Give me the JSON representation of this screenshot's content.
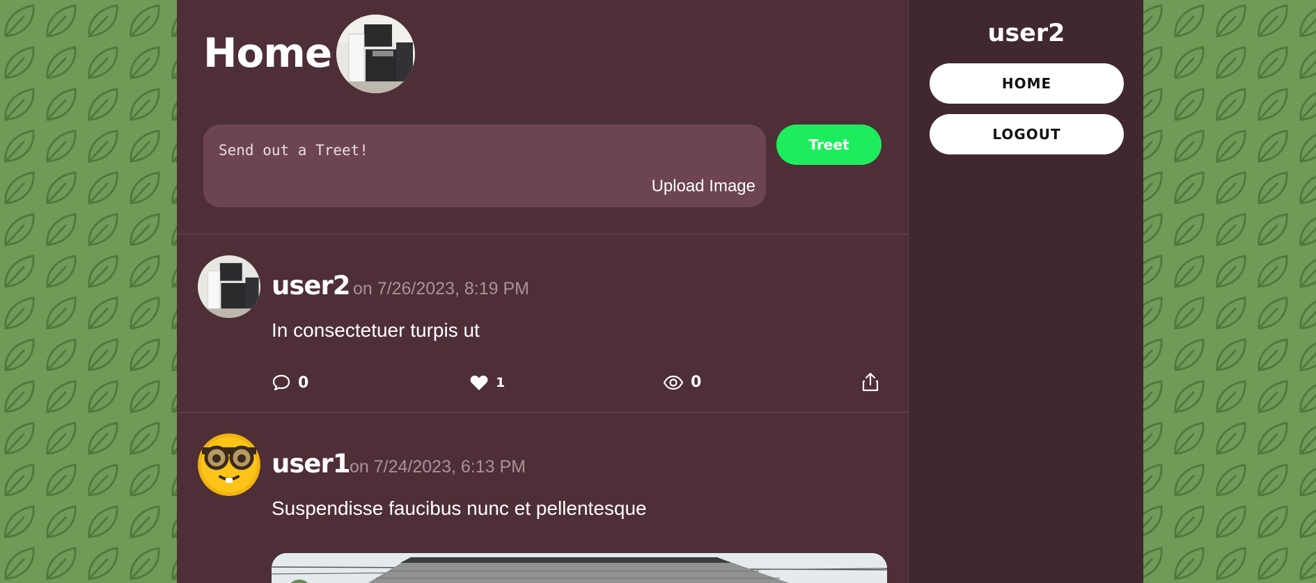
{
  "header": {
    "title": "Home",
    "avatar_icon": "kitchen-photo"
  },
  "compose": {
    "placeholder": "Send out a Treet!",
    "upload_label": "Upload Image",
    "submit_label": "Treet"
  },
  "posts": [
    {
      "username": "user2",
      "date": "on 7/26/2023, 8:19 PM",
      "text": "In consectetuer turpis ut",
      "comments": "0",
      "likes": "1",
      "views": "0",
      "avatar_icon": "kitchen-photo"
    },
    {
      "username": "user1",
      "date": "on 7/24/2023, 6:13 PM",
      "text": "Suspendisse faucibus nunc et pellentesque",
      "avatar_icon": "nerd-face-emoji",
      "image_icon": "house-photo"
    }
  ],
  "sidebar": {
    "username": "user2",
    "nav": [
      {
        "label": "HOME"
      },
      {
        "label": "LOGOUT"
      }
    ]
  },
  "colors": {
    "background": "#6f9a58",
    "feed": "#4f2f37",
    "sidebar": "#402730",
    "accent": "#1ded5d",
    "compose": "#6c4550"
  }
}
